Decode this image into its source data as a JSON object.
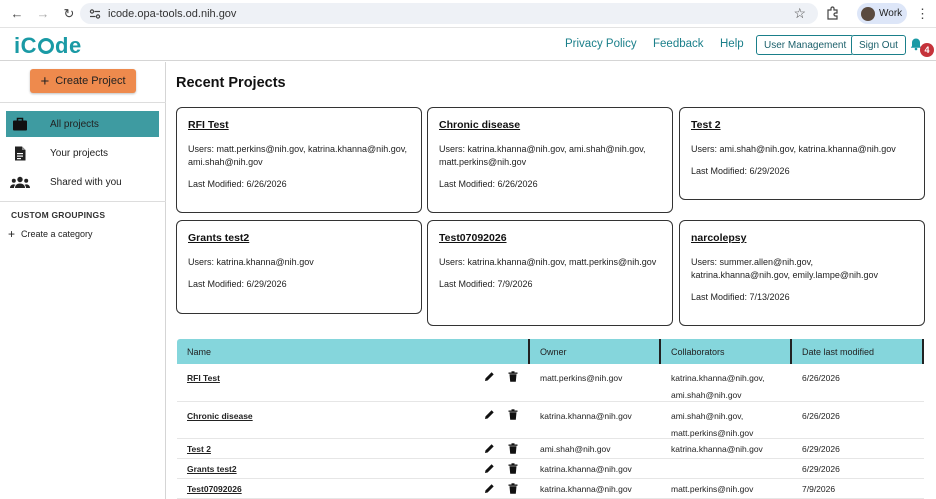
{
  "browser": {
    "url": "icode.opa-tools.od.nih.gov",
    "profile_label": "Work"
  },
  "header": {
    "logo": "iCode",
    "links": [
      "Privacy Policy",
      "Feedback",
      "Help"
    ],
    "user_management": "User Management",
    "sign_out": "Sign Out",
    "notification_count": "4"
  },
  "sidebar": {
    "create_project": "Create Project",
    "items": [
      {
        "label": "All projects",
        "icon": "briefcase-icon"
      },
      {
        "label": "Your projects",
        "icon": "document-icon"
      },
      {
        "label": "Shared with you",
        "icon": "people-icon"
      }
    ],
    "custom_heading": "CUSTOM GROUPINGS",
    "create_category": "Create a category"
  },
  "main": {
    "title": "Recent Projects",
    "cards": [
      {
        "title": "RFI Test",
        "users": "Users: matt.perkins@nih.gov, katrina.khanna@nih.gov, ami.shah@nih.gov",
        "modified": "Last Modified: 6/26/2026"
      },
      {
        "title": "Chronic disease",
        "users": "Users: katrina.khanna@nih.gov, ami.shah@nih.gov, matt.perkins@nih.gov",
        "modified": "Last Modified: 6/26/2026"
      },
      {
        "title": "Test 2",
        "users": "Users: ami.shah@nih.gov, katrina.khanna@nih.gov",
        "modified": "Last Modified: 6/29/2026"
      },
      {
        "title": "Grants test2",
        "users": "Users: katrina.khanna@nih.gov",
        "modified": "Last Modified: 6/29/2026"
      },
      {
        "title": "Test07092026",
        "users": "Users: katrina.khanna@nih.gov, matt.perkins@nih.gov",
        "modified": "Last Modified: 7/9/2026"
      },
      {
        "title": "narcolepsy",
        "users": "Users: summer.allen@nih.gov, katrina.khanna@nih.gov, emily.lampe@nih.gov",
        "modified": "Last Modified: 7/13/2026"
      }
    ],
    "table": {
      "headers": [
        "Name",
        "Owner",
        "Collaborators",
        "Date last modified"
      ],
      "rows": [
        {
          "name": "RFI Test",
          "owner": "matt.perkins@nih.gov",
          "collab1": "katrina.khanna@nih.gov,",
          "collab2": "ami.shah@nih.gov",
          "date": "6/26/2026"
        },
        {
          "name": "Chronic disease",
          "owner": "katrina.khanna@nih.gov",
          "collab1": "ami.shah@nih.gov,",
          "collab2": "matt.perkins@nih.gov",
          "date": "6/26/2026"
        },
        {
          "name": "Test 2",
          "owner": "ami.shah@nih.gov",
          "collab1": "katrina.khanna@nih.gov",
          "collab2": "",
          "date": "6/29/2026"
        },
        {
          "name": "Grants test2",
          "owner": "katrina.khanna@nih.gov",
          "collab1": "",
          "collab2": "",
          "date": "6/29/2026"
        },
        {
          "name": "Test07092026",
          "owner": "katrina.khanna@nih.gov",
          "collab1": "matt.perkins@nih.gov",
          "collab2": "",
          "date": "7/9/2026"
        }
      ]
    }
  },
  "colors": {
    "brand": "#1a9aa5",
    "accent_button": "#ee8a4d",
    "sidebar_active": "#3e9ba1",
    "table_header": "#85d6dc",
    "badge": "#c5323a"
  }
}
